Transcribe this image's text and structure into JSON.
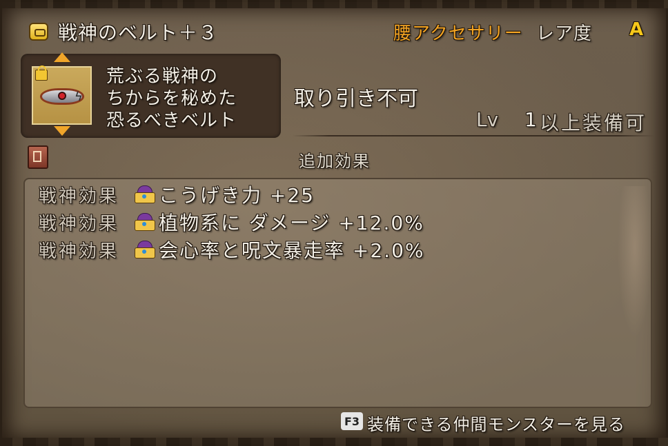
{
  "header": {
    "item_name": "戦神のベルト＋３",
    "category": "腰アクセサリー",
    "rarity_label": "レア度",
    "rarity_value": "A"
  },
  "description": {
    "lines": [
      "荒ぶる戦神の",
      "ちからを秘めた",
      "恐るべきベルト"
    ]
  },
  "info": {
    "trade_status": "取り引き不可",
    "level_label": "Lv",
    "level_value": "1",
    "level_suffix": "以上装備可"
  },
  "effects_section": {
    "title": "追加効果",
    "effects": [
      {
        "label": "戦神効果",
        "text": "こうげき力 +25"
      },
      {
        "label": "戦神効果",
        "text": "植物系に ダメージ +12.0%"
      },
      {
        "label": "戦神効果",
        "text": "会心率と呪文暴走率 +2.0%"
      }
    ]
  },
  "footer": {
    "key": "F3",
    "text": "装備できる仲間モンスターを見る"
  },
  "colors": {
    "category": "#f3a423",
    "rarity": "#f6c81a",
    "arrow": "#f0a52a"
  },
  "icons": {
    "item_type": "belt-icon",
    "lock": "lock-icon",
    "book": "book-icon",
    "effect": "crown-icon"
  }
}
